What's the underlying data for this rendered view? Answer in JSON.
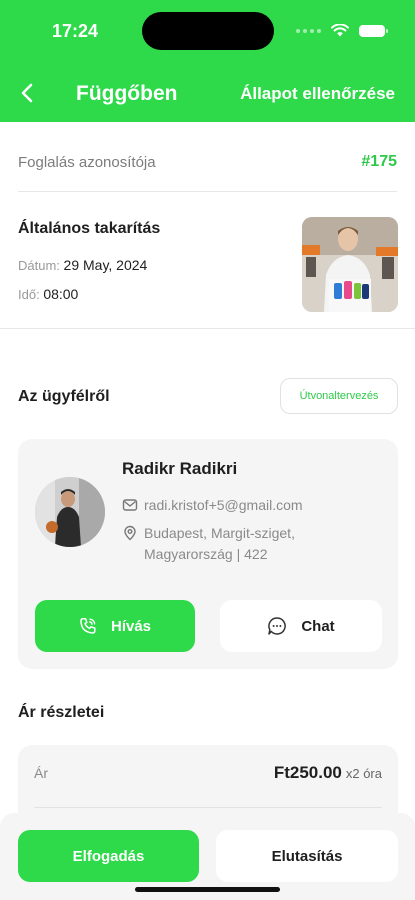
{
  "status_bar": {
    "time": "17:24"
  },
  "header": {
    "title": "Függőben",
    "action_label": "Állapot ellenőrzése",
    "back_icon": "chevron-left-icon"
  },
  "booking": {
    "id_label": "Foglalás azonosítója",
    "id_value": "#175",
    "service_title": "Általános takarítás",
    "date_label": "Dátum:",
    "date_value": "29 May, 2024",
    "time_label": "Idő:",
    "time_value": "08:00"
  },
  "customer": {
    "section_title": "Az ügyfélről",
    "route_button": "Útvonaltervezés",
    "name": "Radikr Radikri",
    "email": "radi.kristof+5@gmail.com",
    "address_line1": "Budapest, Margit-sziget,",
    "address_line2": "Magyarország | 422",
    "call_label": "Hívás",
    "chat_label": "Chat"
  },
  "pricing": {
    "section_title": "Ár részletei",
    "price_label": "Ár",
    "price_value": "Ft250.00",
    "price_unit": "x2 óra"
  },
  "actions": {
    "accept_label": "Elfogadás",
    "reject_label": "Elutasítás"
  },
  "colors": {
    "accent": "#2ed94a",
    "card_bg": "#f5f5f5"
  }
}
